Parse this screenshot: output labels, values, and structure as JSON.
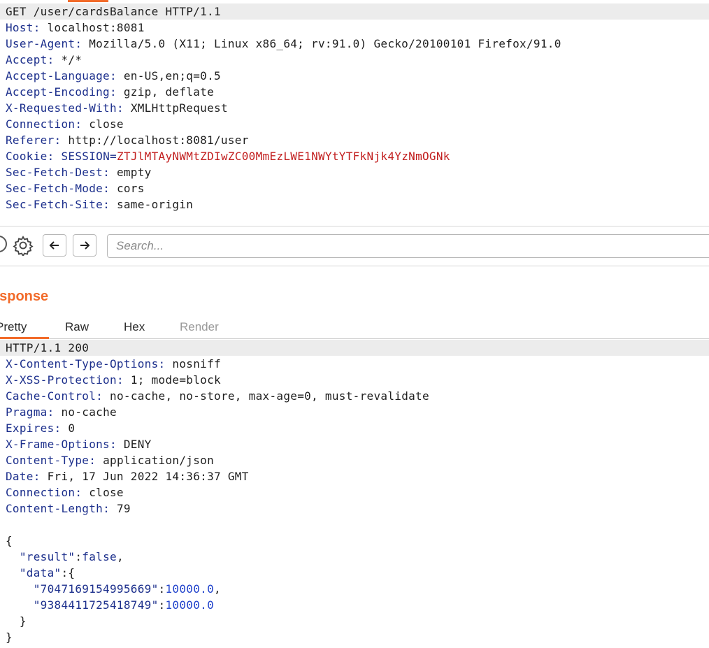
{
  "request": {
    "request_line": "GET /user/cardsBalance HTTP/1.1",
    "headers": [
      {
        "name": "Host",
        "value": "localhost:8081"
      },
      {
        "name": "User-Agent",
        "value": "Mozilla/5.0 (X11; Linux x86_64; rv:91.0) Gecko/20100101 Firefox/91.0"
      },
      {
        "name": "Accept",
        "value": "*/*"
      },
      {
        "name": "Accept-Language",
        "value": "en-US,en;q=0.5"
      },
      {
        "name": "Accept-Encoding",
        "value": "gzip, deflate"
      },
      {
        "name": "X-Requested-With",
        "value": "XMLHttpRequest"
      },
      {
        "name": "Connection",
        "value": "close"
      },
      {
        "name": "Referer",
        "value": "http://localhost:8081/user"
      }
    ],
    "cookie": {
      "label": "Cookie",
      "name": "SESSION",
      "value": "ZTJlMTAyNWMtZDIwZC00MmEzLWE1NWYtYTFkNjk4YzNmOGNk"
    },
    "headers_after": [
      {
        "name": "Sec-Fetch-Dest",
        "value": "empty"
      },
      {
        "name": "Sec-Fetch-Mode",
        "value": "cors"
      },
      {
        "name": "Sec-Fetch-Site",
        "value": "same-origin"
      }
    ]
  },
  "search": {
    "placeholder": "Search..."
  },
  "response": {
    "title": "esponse",
    "tabs": {
      "pretty": "Pretty",
      "raw": "Raw",
      "hex": "Hex",
      "render": "Render"
    },
    "status_line": "HTTP/1.1 200",
    "headers": [
      {
        "name": "X-Content-Type-Options",
        "value": "nosniff"
      },
      {
        "name": "X-XSS-Protection",
        "value": "1; mode=block"
      },
      {
        "name": "Cache-Control",
        "value": "no-cache, no-store, max-age=0, must-revalidate"
      },
      {
        "name": "Pragma",
        "value": "no-cache"
      },
      {
        "name": "Expires",
        "value": "0"
      },
      {
        "name": "X-Frame-Options",
        "value": "DENY"
      },
      {
        "name": "Content-Type",
        "value": "application/json"
      },
      {
        "name": "Date",
        "value": "Fri, 17 Jun 2022 14:36:37 GMT"
      },
      {
        "name": "Connection",
        "value": "close"
      },
      {
        "name": "Content-Length",
        "value": "79"
      }
    ],
    "body": {
      "open_brace": "{",
      "result_key": "\"result\"",
      "result_value": "false",
      "data_key": "\"data\"",
      "cards": [
        {
          "key": "\"7047169154995669\"",
          "value": "10000.0"
        },
        {
          "key": "\"9384411725418749\"",
          "value": "10000.0"
        }
      ],
      "inner_close": "}",
      "close_brace": "}"
    }
  },
  "colors": {
    "accent": "#f26b2a",
    "key": "#1c2f8c",
    "cookie_value": "#c21f1f",
    "number": "#2244cc"
  }
}
